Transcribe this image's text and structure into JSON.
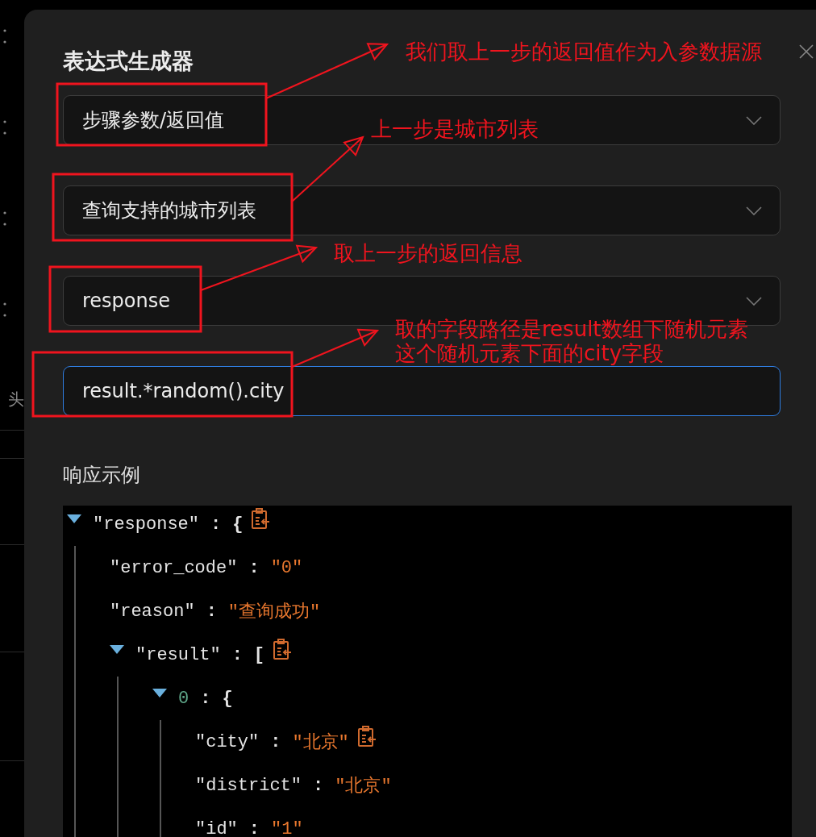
{
  "background": {
    "label": "头"
  },
  "dialog": {
    "title": "表达式生成器",
    "fields": [
      {
        "kind": "select",
        "value": "步骤参数/返回值",
        "focused": false
      },
      {
        "kind": "select",
        "value": "查询支持的城市列表",
        "focused": false
      },
      {
        "kind": "select",
        "value": "response",
        "focused": false
      },
      {
        "kind": "input",
        "value": "result.*random().city",
        "focused": true
      }
    ],
    "example_label": "响应示例",
    "example_tree": [
      {
        "key": "\"response\"",
        "kind": "object",
        "sep": ":",
        "value": "{",
        "expanded": true,
        "copy": true,
        "children": [
          {
            "key": "\"error_code\"",
            "kind": "string",
            "sep": ":",
            "value": "\"0\"",
            "copy": false
          },
          {
            "key": "\"reason\"",
            "kind": "string",
            "sep": ":",
            "value": "\"查询成功\"",
            "copy": false
          },
          {
            "key": "\"result\"",
            "kind": "array",
            "sep": ":",
            "value": "[",
            "expanded": true,
            "copy": true,
            "children": [
              {
                "key": "0",
                "kind": "item",
                "sep": ":",
                "value": "{",
                "expanded": true,
                "copy": false,
                "children": [
                  {
                    "key": "\"city\"",
                    "kind": "string",
                    "sep": ":",
                    "value": "\"北京\"",
                    "copy": true
                  },
                  {
                    "key": "\"district\"",
                    "kind": "string",
                    "sep": ":",
                    "value": "\"北京\"",
                    "copy": false
                  },
                  {
                    "key": "\"id\"",
                    "kind": "string",
                    "sep": ":",
                    "value": "\"1\"",
                    "copy": false
                  }
                ]
              }
            ]
          }
        ]
      }
    ]
  },
  "annotations": [
    {
      "lines": [
        "我们取上一步的返回值作为入参数据源"
      ]
    },
    {
      "lines": [
        "上一步是城市列表"
      ]
    },
    {
      "lines": [
        "取上一步的返回信息"
      ]
    },
    {
      "lines": [
        "取的字段路径是result数组下随机元素",
        "这个随机元素下面的city字段"
      ]
    }
  ]
}
